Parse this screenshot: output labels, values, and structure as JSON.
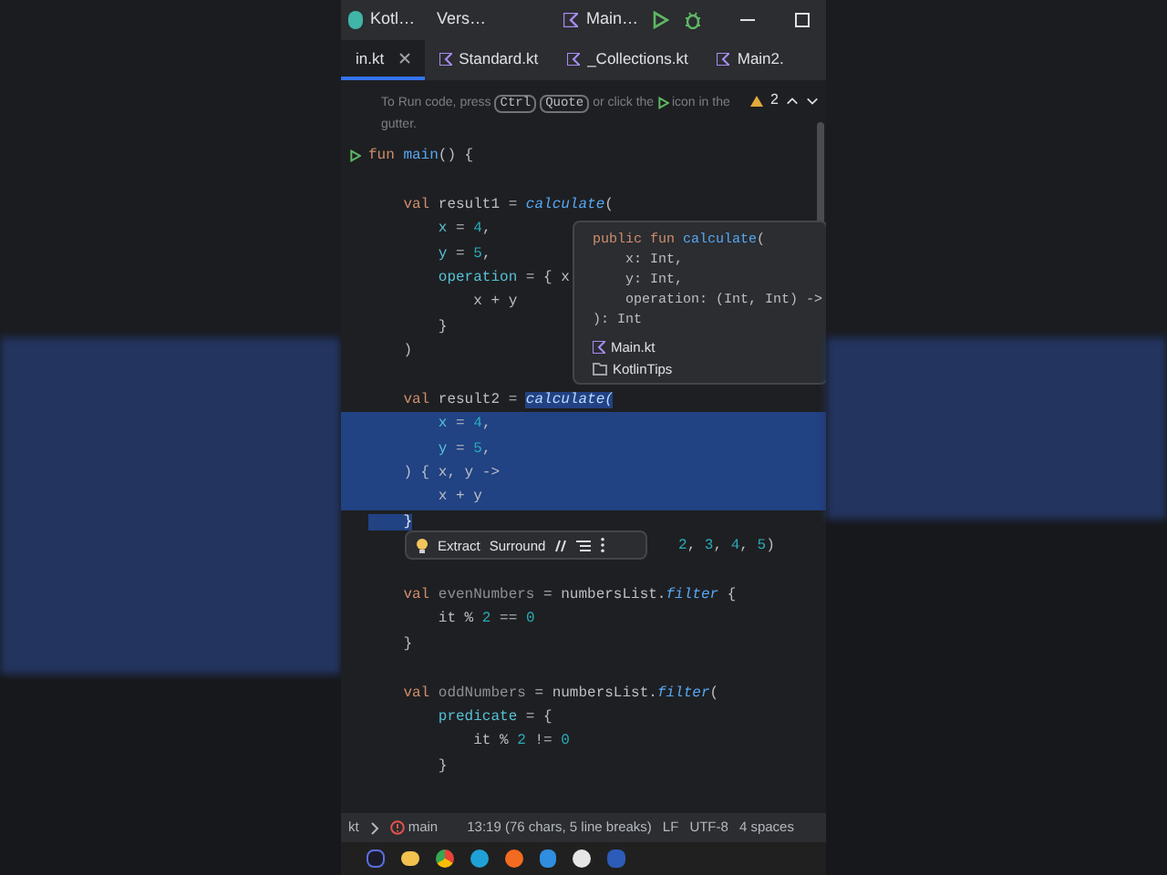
{
  "toolbar": {
    "project": "Kotl…",
    "vcs": "Vers…",
    "run_config": "Main…"
  },
  "tabs": [
    {
      "label": "in.kt",
      "selected": true,
      "closable": true
    },
    {
      "label": "Standard.kt",
      "selected": false,
      "closable": false
    },
    {
      "label": "_Collections.kt",
      "selected": false,
      "closable": false
    },
    {
      "label": "Main2.",
      "selected": false,
      "closable": false
    }
  ],
  "inspections": {
    "warnings": "2"
  },
  "hint": {
    "before": "To Run code, press",
    "keys": [
      "Ctrl",
      "Quote"
    ],
    "middle": "or click the",
    "after": "icon in the",
    "line2": "gutter."
  },
  "code": [
    {
      "run": true,
      "full": false,
      "tokens": [
        {
          "t": "fun ",
          "kind": "kw"
        },
        {
          "t": "main",
          "kind": "fn"
        },
        {
          "t": "() {",
          "kind": "plain"
        }
      ]
    },
    {
      "run": false,
      "full": false
    },
    {
      "run": false,
      "full": false,
      "tokens": [
        {
          "t": "    val ",
          "kind": "kw"
        },
        {
          "t": "result1 = ",
          "kind": "plain"
        },
        {
          "t": "calculate",
          "kind": "call"
        },
        {
          "t": "(",
          "kind": "plain"
        }
      ]
    },
    {
      "run": false,
      "full": false,
      "tokens": [
        {
          "t": "        x",
          "kind": "param"
        },
        {
          "t": " = ",
          "kind": "plain"
        },
        {
          "t": "4",
          "kind": "num"
        },
        {
          "t": ",",
          "kind": "plain"
        }
      ]
    },
    {
      "run": false,
      "full": false,
      "tokens": [
        {
          "t": "        y",
          "kind": "param"
        },
        {
          "t": " = ",
          "kind": "plain"
        },
        {
          "t": "5",
          "kind": "num"
        },
        {
          "t": ",",
          "kind": "plain"
        }
      ]
    },
    {
      "run": false,
      "full": false,
      "tokens": [
        {
          "t": "        operation",
          "kind": "param"
        },
        {
          "t": " = { x",
          "kind": "plain"
        }
      ]
    },
    {
      "run": false,
      "full": false,
      "tokens": [
        {
          "t": "            x + y",
          "kind": "plain"
        }
      ]
    },
    {
      "run": false,
      "full": false,
      "tokens": [
        {
          "t": "        }",
          "kind": "plain"
        }
      ]
    },
    {
      "run": false,
      "full": false,
      "tokens": [
        {
          "t": "    )",
          "kind": "plain"
        }
      ]
    },
    {
      "run": false,
      "full": false
    },
    {
      "run": false,
      "full": false,
      "tokens": [
        {
          "t": "    val ",
          "kind": "kw"
        },
        {
          "t": "result2 = ",
          "kind": "plain"
        },
        {
          "t": "calculate(",
          "kind": "call",
          "selected": true
        }
      ]
    },
    {
      "run": false,
      "full": true,
      "tokens": [
        {
          "t": "        x",
          "kind": "param"
        },
        {
          "t": " = ",
          "kind": "plain"
        },
        {
          "t": "4",
          "kind": "num"
        },
        {
          "t": ",",
          "kind": "plain"
        }
      ]
    },
    {
      "run": false,
      "full": true,
      "tokens": [
        {
          "t": "        y",
          "kind": "param"
        },
        {
          "t": " = ",
          "kind": "plain"
        },
        {
          "t": "5",
          "kind": "num"
        },
        {
          "t": ",",
          "kind": "plain"
        }
      ]
    },
    {
      "run": false,
      "full": true,
      "tokens": [
        {
          "t": "    ) { x, y ->",
          "kind": "plain"
        }
      ]
    },
    {
      "run": false,
      "full": true,
      "tokens": [
        {
          "t": "        x + y",
          "kind": "plain"
        }
      ]
    },
    {
      "run": false,
      "full": false,
      "tokens": [
        {
          "t": "    }",
          "kind": "plain",
          "selected": true
        }
      ]
    },
    {
      "run": false,
      "full": false,
      "intentions": [
        "Extract",
        "Surround"
      ],
      "tokens": [
        {
          "t": "2",
          "kind": "num"
        },
        {
          "t": ", ",
          "kind": "plain"
        },
        {
          "t": "3",
          "kind": "num"
        },
        {
          "t": ", ",
          "kind": "plain"
        },
        {
          "t": "4",
          "kind": "num"
        },
        {
          "t": ", ",
          "kind": "plain"
        },
        {
          "t": "5",
          "kind": "num"
        },
        {
          "t": ")",
          "kind": "plain"
        }
      ]
    },
    {
      "run": false,
      "full": false
    },
    {
      "run": false,
      "full": false,
      "tokens": [
        {
          "t": "    val ",
          "kind": "kw"
        },
        {
          "t": "evenNumbers",
          "kind": "unused"
        },
        {
          "t": " = numbersList.",
          "kind": "plain"
        },
        {
          "t": "filter",
          "kind": "call"
        },
        {
          "t": " {",
          "kind": "plain"
        }
      ]
    },
    {
      "run": false,
      "full": false,
      "tokens": [
        {
          "t": "        it % ",
          "kind": "plain"
        },
        {
          "t": "2",
          "kind": "num"
        },
        {
          "t": " == ",
          "kind": "plain"
        },
        {
          "t": "0",
          "kind": "num"
        }
      ]
    },
    {
      "run": false,
      "full": false,
      "tokens": [
        {
          "t": "    }",
          "kind": "plain"
        }
      ]
    },
    {
      "run": false,
      "full": false
    },
    {
      "run": false,
      "full": false,
      "tokens": [
        {
          "t": "    val ",
          "kind": "kw"
        },
        {
          "t": "oddNumbers",
          "kind": "unused"
        },
        {
          "t": " = numbersList.",
          "kind": "plain"
        },
        {
          "t": "filter",
          "kind": "call"
        },
        {
          "t": "(",
          "kind": "plain"
        }
      ]
    },
    {
      "run": false,
      "full": false,
      "tokens": [
        {
          "t": "        predicate",
          "kind": "param"
        },
        {
          "t": " = {",
          "kind": "plain"
        }
      ]
    },
    {
      "run": false,
      "full": false,
      "tokens": [
        {
          "t": "            it % ",
          "kind": "plain"
        },
        {
          "t": "2",
          "kind": "num"
        },
        {
          "t": " != ",
          "kind": "plain"
        },
        {
          "t": "0",
          "kind": "num"
        }
      ]
    },
    {
      "run": false,
      "full": false,
      "tokens": [
        {
          "t": "        }",
          "kind": "plain"
        }
      ]
    }
  ],
  "doc_popup": {
    "signature": [
      {
        "tokens": [
          {
            "t": "public fun ",
            "kind": "kw"
          },
          {
            "t": "calculate",
            "kind": "fn"
          },
          {
            "t": "(",
            "kind": "plain"
          }
        ]
      },
      {
        "tokens": [
          {
            "t": "    x: Int,",
            "kind": "plain"
          }
        ]
      },
      {
        "tokens": [
          {
            "t": "    y: Int,",
            "kind": "plain"
          }
        ]
      },
      {
        "tokens": [
          {
            "t": "    operation: (Int, Int) ->",
            "kind": "plain"
          }
        ]
      },
      {
        "tokens": [
          {
            "t": "): Int",
            "kind": "plain"
          }
        ]
      }
    ],
    "locations": [
      {
        "kind": "file",
        "label": "Main.kt"
      },
      {
        "kind": "module",
        "label": "KotlinTips"
      }
    ]
  },
  "status_bar": {
    "breadcrumb": "kt",
    "branch": "main",
    "position": "13:19 (76 chars, 5 line breaks)",
    "line_sep": "LF",
    "encoding": "UTF-8",
    "indent": "4 spaces"
  }
}
